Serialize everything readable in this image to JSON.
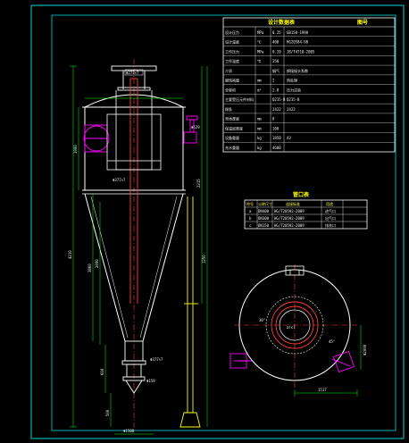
{
  "sheet": {
    "background": "#000000",
    "frame_color": "#00d8d8",
    "main_line_color": "#ffffff",
    "centerline_color": "#ff4040",
    "dimension_color": "#00ff00",
    "nozzle_color": "#ff00ff",
    "text_color": "#ffff00"
  },
  "spec_table": {
    "title": "设计数据表",
    "title_right": "图号",
    "rows": [
      {
        "name": "设计压力",
        "unit": "MPa",
        "value": "0.25",
        "note": "GB150-1998"
      },
      {
        "name": "设计温度",
        "unit": "℃",
        "value": "400",
        "note": "HG20584-98"
      },
      {
        "name": "工作压力",
        "unit": "MPa",
        "value": "0.20",
        "note": "JB/T4710-2005"
      },
      {
        "name": "工作温度",
        "unit": "℃",
        "value": "350",
        "note": ""
      },
      {
        "name": "介质",
        "unit": "",
        "value": "烟气",
        "note": "焊接接头系数"
      },
      {
        "name": "腐蚀裕量",
        "unit": "mm",
        "value": "2",
        "note": "热处理"
      },
      {
        "name": "全容积",
        "unit": "m³",
        "value": "2.8",
        "note": "压力试验"
      },
      {
        "name": "主要受压元件材料",
        "unit": "",
        "value": "Q235-B",
        "note": "Q235-B"
      },
      {
        "name": "焊条",
        "unit": "",
        "value": "J422",
        "note": "J422"
      },
      {
        "name": "壳体厚度",
        "unit": "mm",
        "value": "8",
        "note": ""
      },
      {
        "name": "保温层厚度",
        "unit": "mm",
        "value": "100",
        "note": ""
      },
      {
        "name": "设备重量",
        "unit": "kg",
        "value": "1850",
        "note": "A3"
      },
      {
        "name": "充水重量",
        "unit": "kg",
        "value": "4600",
        "note": ""
      }
    ]
  },
  "nozzle_table": {
    "title": "管口表",
    "headers": [
      "符号",
      "公称尺寸",
      "连接标准",
      "用途"
    ],
    "rows": [
      {
        "mark": "a",
        "size": "DN400",
        "std": "HG/T20592-2009",
        "use": "进气口"
      },
      {
        "mark": "b",
        "size": "DN300",
        "std": "HG/T20592-2009",
        "use": "出气口"
      },
      {
        "mark": "c",
        "size": "DN150",
        "std": "HG/T20592-2009",
        "use": "排灰口"
      }
    ]
  },
  "elevation": {
    "top_tag": "Φ273×7",
    "inlet_tag": "Φ377×7",
    "top_flange": "Φ529",
    "cone_tag": "Φ377×7",
    "outlet_tag": "Φ159",
    "bottom_tag": "Φ1500",
    "dims": [
      "4210",
      "1900",
      "3860",
      "600",
      "2890",
      "2215",
      "500",
      "1250"
    ]
  },
  "plan": {
    "center_label": "a(c)",
    "dim_a": "1517",
    "dim_b": "Φ2000",
    "angle_a": "30°",
    "angle_b": "45°"
  }
}
